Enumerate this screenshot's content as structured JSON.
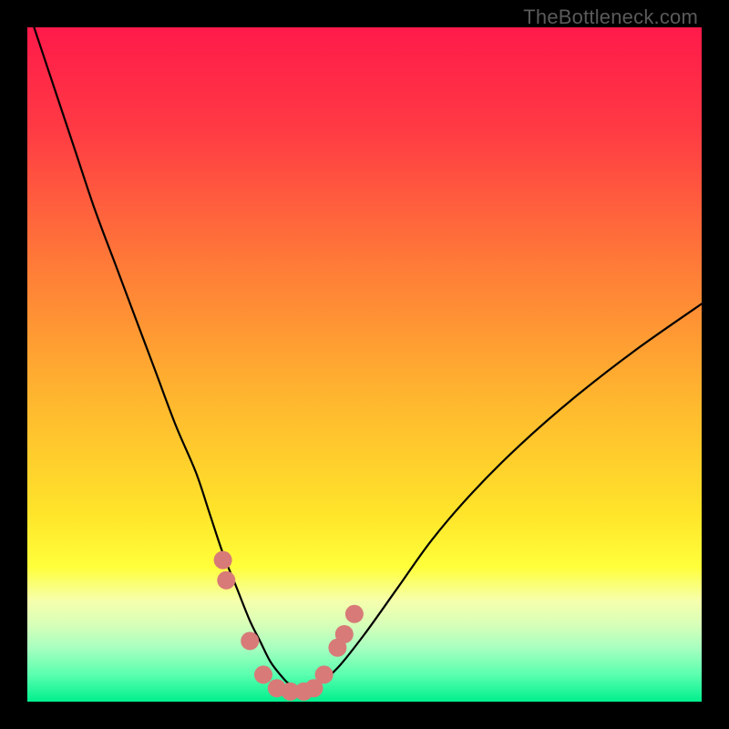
{
  "watermark": "TheBottleneck.com",
  "chart_data": {
    "type": "line",
    "title": "",
    "xlabel": "",
    "ylabel": "",
    "xlim": [
      0,
      100
    ],
    "ylim": [
      0,
      100
    ],
    "grid": false,
    "legend": false,
    "background": {
      "type": "vertical-gradient",
      "stops": [
        {
          "offset": 0.0,
          "color": "#ff1a4a"
        },
        {
          "offset": 0.15,
          "color": "#ff3a44"
        },
        {
          "offset": 0.35,
          "color": "#ff7a38"
        },
        {
          "offset": 0.55,
          "color": "#ffb62f"
        },
        {
          "offset": 0.72,
          "color": "#ffe42a"
        },
        {
          "offset": 0.8,
          "color": "#ffff3a"
        },
        {
          "offset": 0.85,
          "color": "#f6ffac"
        },
        {
          "offset": 0.885,
          "color": "#d8ffb8"
        },
        {
          "offset": 0.92,
          "color": "#a8ffc0"
        },
        {
          "offset": 0.96,
          "color": "#5affaf"
        },
        {
          "offset": 1.0,
          "color": "#00ef8e"
        }
      ]
    },
    "series": [
      {
        "name": "bottleneck-curve",
        "color": "#000000",
        "x": [
          1,
          4,
          7,
          10,
          13,
          16,
          19,
          22,
          25,
          27,
          29,
          31,
          33,
          34.5,
          36,
          37.5,
          39,
          41,
          43,
          46,
          50,
          55,
          60,
          66,
          73,
          81,
          90,
          100
        ],
        "y": [
          100,
          91,
          82,
          73,
          65,
          57,
          49,
          41,
          34,
          28,
          22,
          17,
          12,
          9,
          6,
          4,
          2.5,
          2,
          2.5,
          5,
          10,
          17,
          24,
          31,
          38,
          45,
          52,
          59
        ]
      }
    ],
    "markers": {
      "name": "highlight-points",
      "color": "#d87a78",
      "radius": 10,
      "points": [
        {
          "x": 29.0,
          "y": 21
        },
        {
          "x": 29.5,
          "y": 18
        },
        {
          "x": 33.0,
          "y": 9
        },
        {
          "x": 35.0,
          "y": 4
        },
        {
          "x": 37.0,
          "y": 2
        },
        {
          "x": 39.0,
          "y": 1.5
        },
        {
          "x": 41.0,
          "y": 1.5
        },
        {
          "x": 42.5,
          "y": 2
        },
        {
          "x": 44.0,
          "y": 4
        },
        {
          "x": 46.0,
          "y": 8
        },
        {
          "x": 47.0,
          "y": 10
        },
        {
          "x": 48.5,
          "y": 13
        }
      ]
    }
  }
}
